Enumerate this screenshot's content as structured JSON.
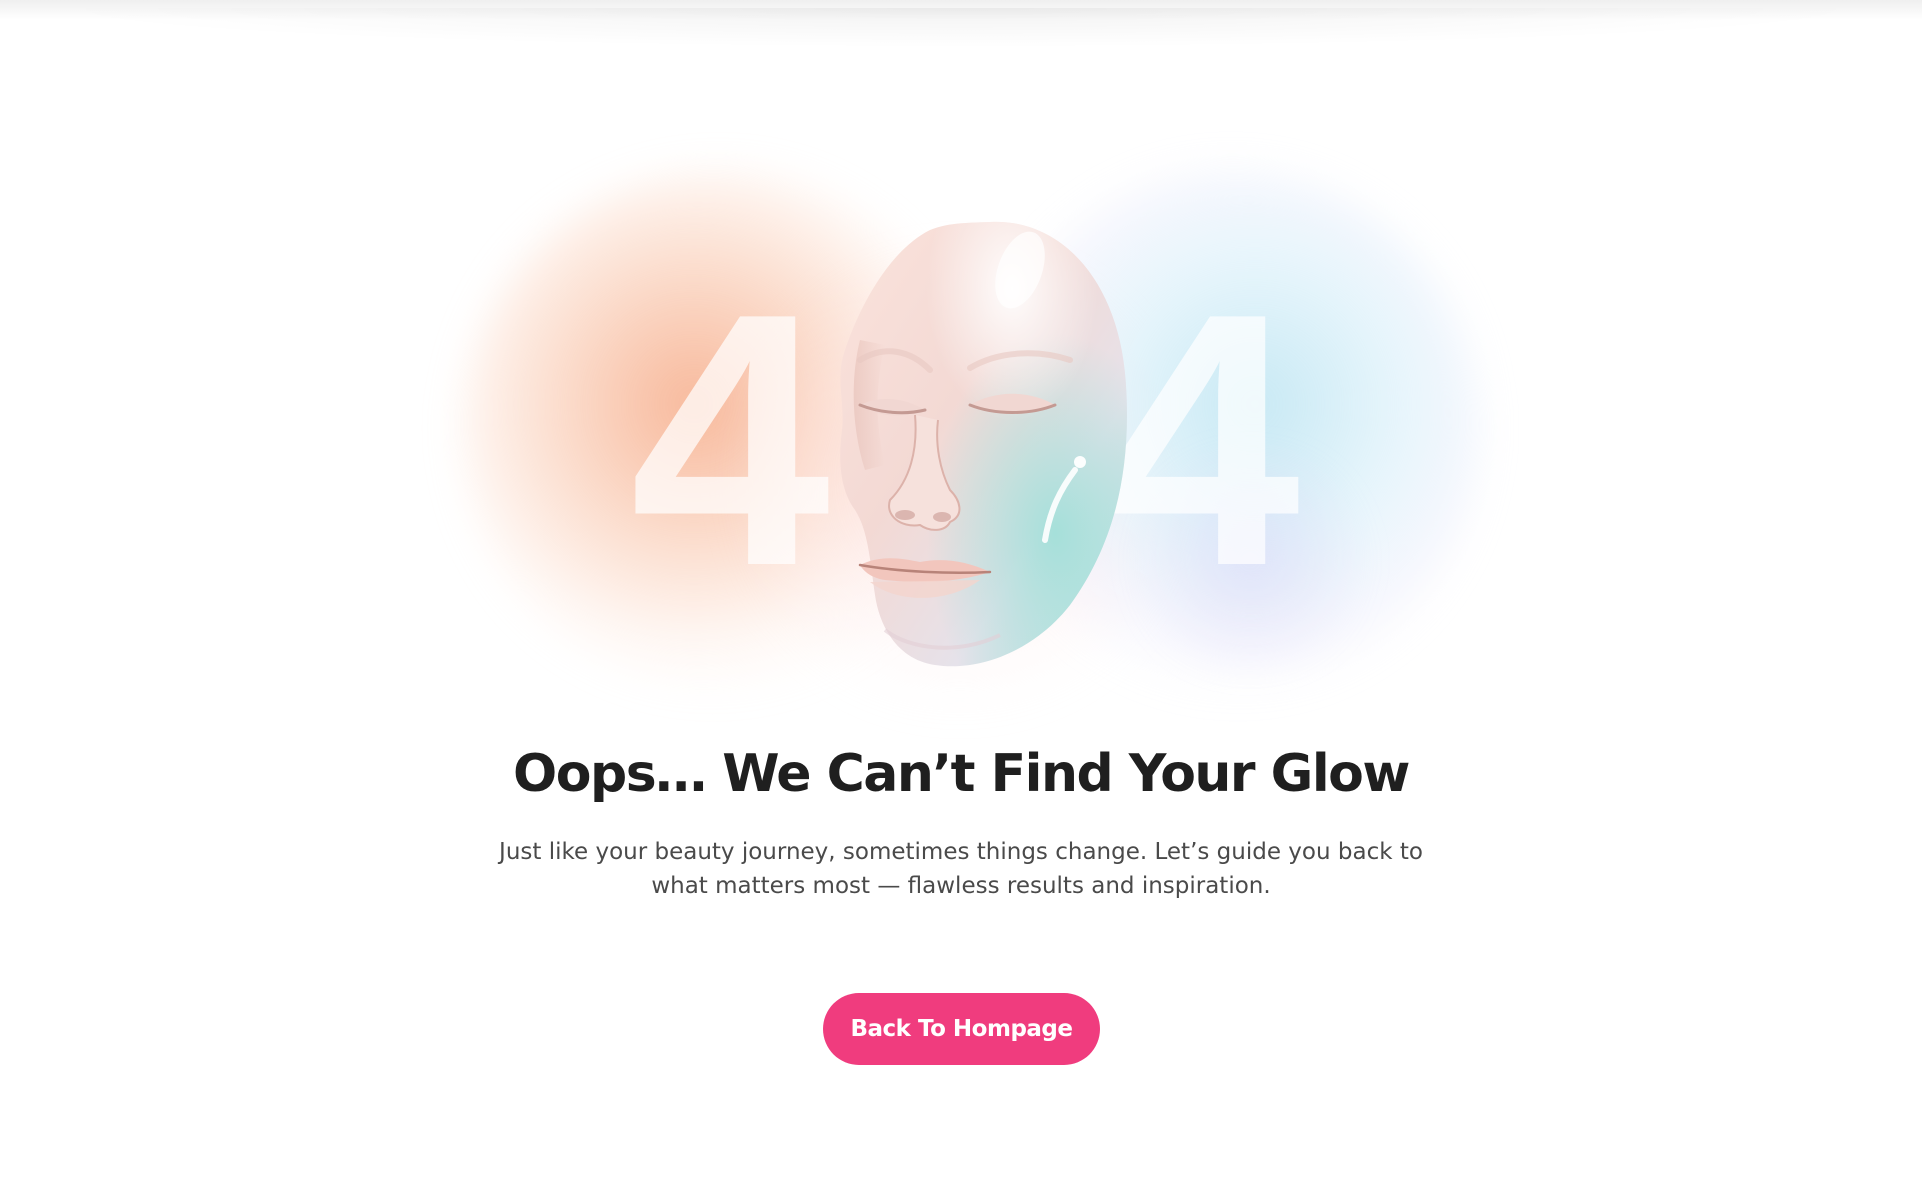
{
  "hero": {
    "digit_left": "4",
    "digit_right": "4"
  },
  "headline": "Oops… We Can’t Find Your Glow",
  "subtext": "Just like your beauty journey, sometimes things change. Let’s guide you back to what matters most — flawless results and inspiration.",
  "cta": {
    "label": "Back To Hompage"
  },
  "colors": {
    "accent": "#f03c7e",
    "headline": "#1f1f1f",
    "body_text": "#4a4a4a",
    "glow_orange": "#f5a078",
    "glow_blue": "#b4e1f0"
  },
  "icons": {
    "hero_image": "3d-face-mask-illustration"
  }
}
